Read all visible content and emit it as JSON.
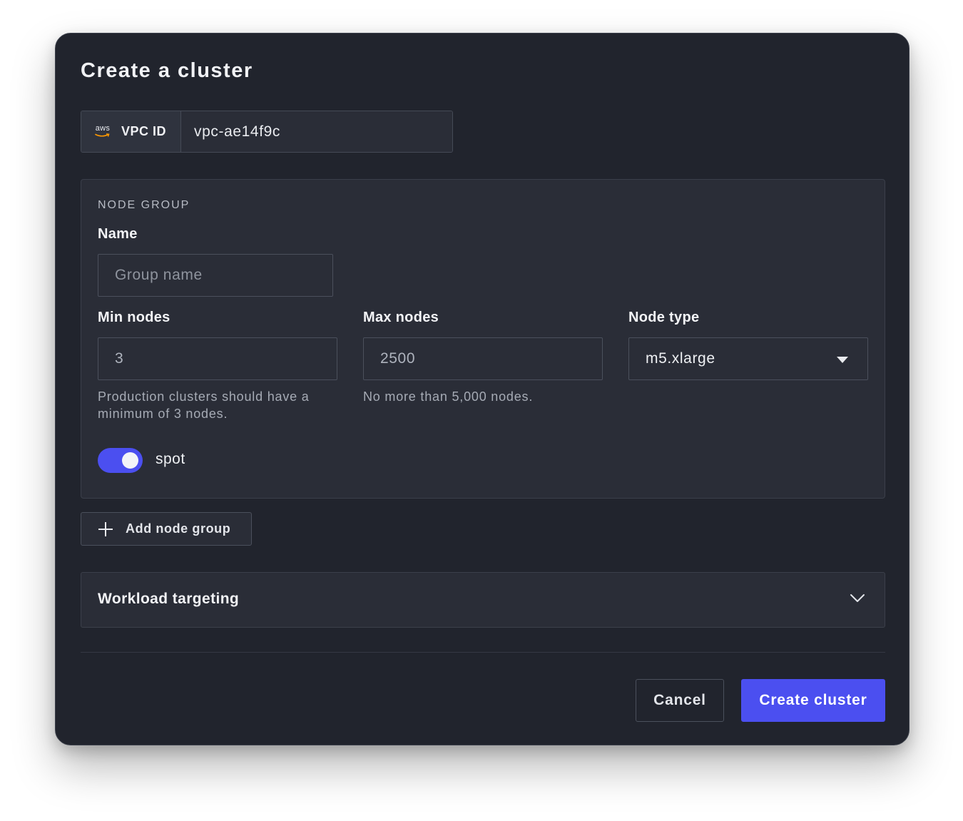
{
  "dialog": {
    "title": "Create a cluster",
    "vpc": {
      "logo_text": "aws",
      "label": "VPC ID",
      "value": "vpc-ae14f9c"
    },
    "node_group": {
      "heading": "NODE GROUP",
      "name": {
        "label": "Name",
        "placeholder": "Group name",
        "value": ""
      },
      "min_nodes": {
        "label": "Min nodes",
        "value": "3",
        "help": "Production clusters should have a minimum of 3 nodes."
      },
      "max_nodes": {
        "label": "Max nodes",
        "value": "2500",
        "help": "No more than 5,000 nodes."
      },
      "node_type": {
        "label": "Node type",
        "selected": "m5.xlarge",
        "icon": "caret-down-icon"
      },
      "spot_toggle": {
        "label": "spot",
        "on": true
      }
    },
    "add_node_group": {
      "label": "Add node group",
      "icon": "plus-icon"
    },
    "workload_targeting": {
      "label": "Workload targeting",
      "icon": "chevron-down-icon"
    },
    "buttons": {
      "cancel": "Cancel",
      "create": "Create cluster"
    },
    "colors": {
      "background": "#21242d",
      "panel": "#2a2d37",
      "accent": "#4b4ff0",
      "aws_orange": "#ff9900"
    }
  }
}
